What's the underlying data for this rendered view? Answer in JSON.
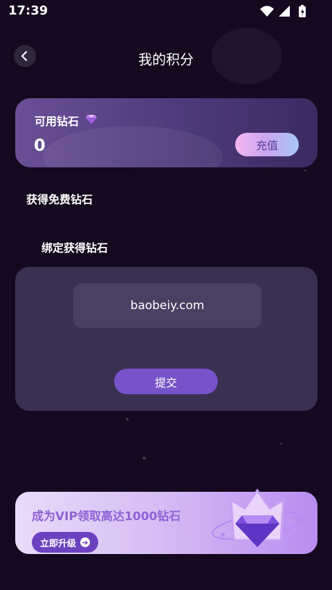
{
  "status_bar": {
    "time": "17:39",
    "icons": [
      "wifi-icon",
      "signal-icon",
      "battery-icon"
    ]
  },
  "header": {
    "title": "我的积分",
    "back_icon": "chevron-left-icon"
  },
  "balance": {
    "label": "可用钻石",
    "value": "0",
    "recharge_label": "充值",
    "icon": "diamond-icon"
  },
  "sections": {
    "free_title": "获得免费钻石",
    "bind_title": "绑定获得钻石"
  },
  "bind_form": {
    "input_value": "baobeiy.com",
    "submit_label": "提交"
  },
  "vip": {
    "text": "成为VIP领取高达1000钻石",
    "button_label": "立即升级",
    "icon": "diamond-crown-icon"
  },
  "colors": {
    "background": "#14091f",
    "accent": "#7653c9",
    "card": "#3a3052"
  }
}
